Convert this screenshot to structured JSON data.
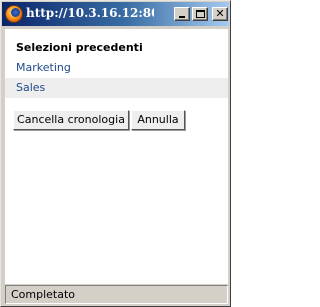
{
  "window": {
    "title": "http://10.3.16.12:8081 - ...",
    "app_icon": "firefox-icon",
    "controls": {
      "minimize": "minimize-icon",
      "maximize": "maximize-icon",
      "close_glyph": "✕"
    }
  },
  "panel": {
    "title": "Selezioni precedenti",
    "items": [
      {
        "label": "Marketing"
      },
      {
        "label": "Sales"
      }
    ],
    "buttons": {
      "clear_label": "Cancella cronologia",
      "cancel_label": "Annulla"
    }
  },
  "status": {
    "text": "Completato"
  },
  "colors": {
    "titlebar_start": "#0a246a",
    "titlebar_end": "#a6caf0",
    "link": "#1f4a8a",
    "alt_row": "#eeeeee",
    "chrome": "#d4d0c8"
  }
}
